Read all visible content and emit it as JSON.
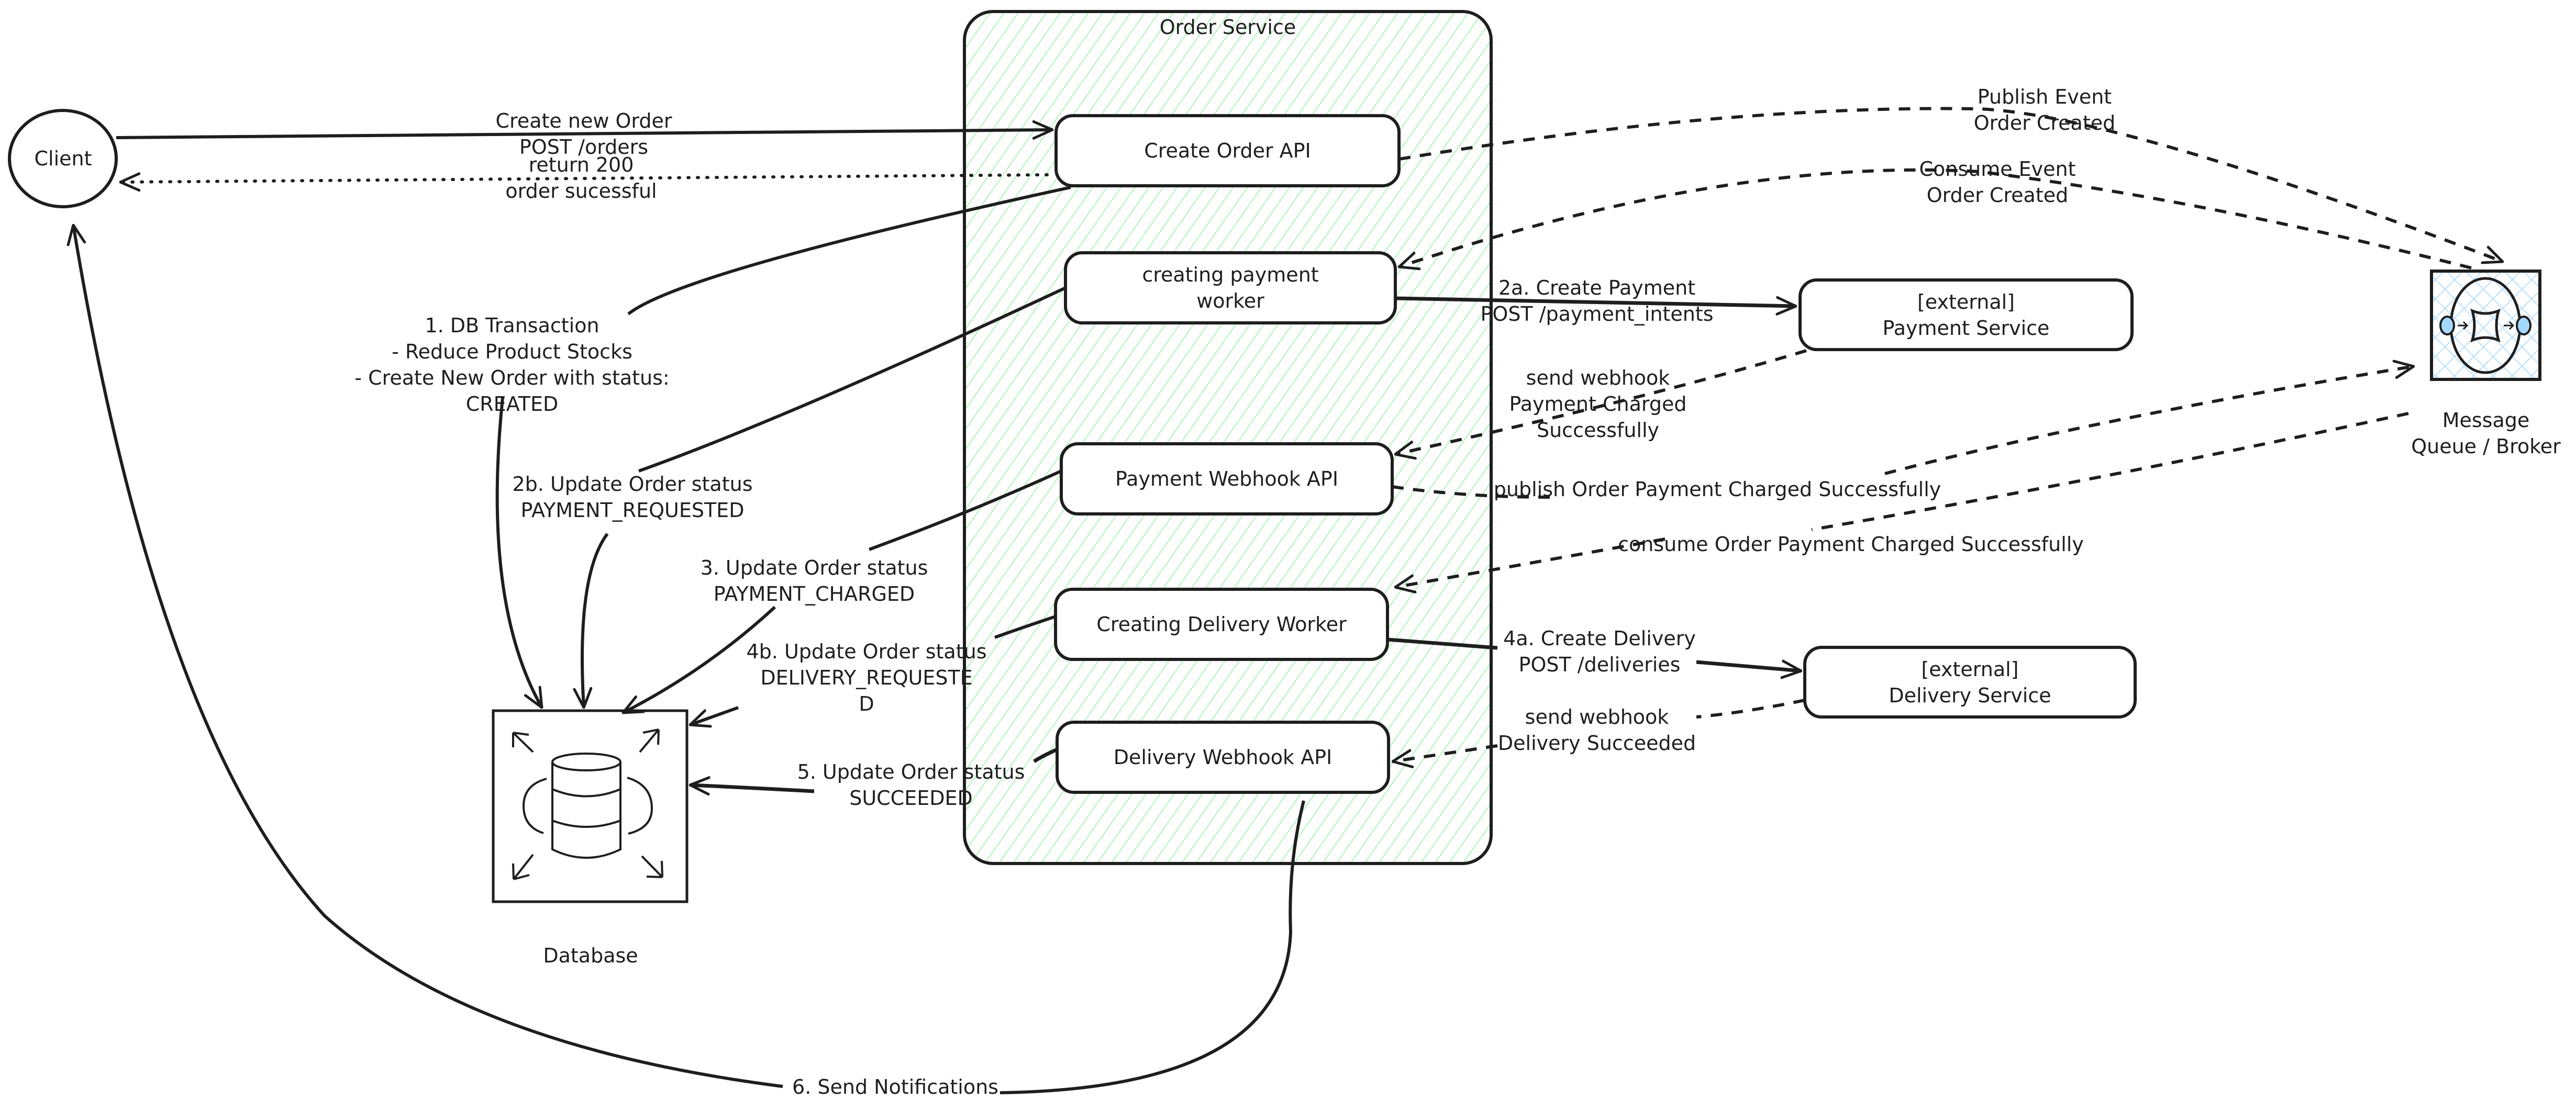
{
  "colors": {
    "stroke": "#1e1e1e",
    "order_service_hatch": "#b2f2bb",
    "queue_hatch": "#a5d8ff",
    "background": "#ffffff"
  },
  "nodes": {
    "client": "Client",
    "order_service": "Order Service",
    "create_order_api": "Create Order API",
    "creating_payment_worker": "creating payment\nworker",
    "payment_webhook_api": "Payment Webhook API",
    "creating_delivery_worker": "Creating Delivery Worker",
    "delivery_webhook_api": "Delivery Webhook API",
    "payment_service": "[external]\nPayment Service",
    "delivery_service": "[external]\nDelivery Service",
    "message_queue": "Message\nQueue / Broker",
    "database": "Database"
  },
  "edges": {
    "create_new_order": "Create new Order\nPOST /orders",
    "return_200": "return 200\norder sucessful",
    "db_transaction": "1. DB Transaction\n- Reduce Product Stocks\n- Create New Order with status:\nCREATED",
    "publish_order_created": "Publish Event\nOrder Created",
    "consume_order_created": "Consume Event\nOrder Created",
    "create_payment": "2a. Create Payment\nPOST /payment_intents",
    "update_payment_requested": "2b. Update Order status\nPAYMENT_REQUESTED",
    "payment_webhook": "send webhook\nPayment Charged\nSuccessfully",
    "publish_payment_charged": "publish Order Payment Charged Successfully",
    "consume_payment_charged": "consume Order Payment Charged Successfully",
    "update_payment_charged": "3. Update Order status\nPAYMENT_CHARGED",
    "create_delivery": "4a. Create Delivery\nPOST /deliveries",
    "update_delivery_requested": "4b. Update Order status\nDELIVERY_REQUESTE\nD",
    "delivery_webhook": "send webhook\nDelivery Succeeded",
    "update_succeeded": "5. Update Order status\nSUCCEEDED",
    "send_notifications": "6. Send Notifications"
  }
}
